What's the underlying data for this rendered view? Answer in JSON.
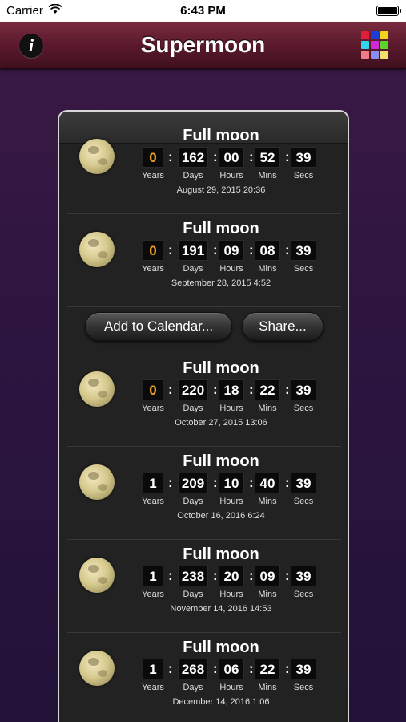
{
  "status_bar": {
    "carrier": "Carrier",
    "time": "6:43 PM"
  },
  "nav": {
    "title": "Supermoon",
    "info_label": "i"
  },
  "unit_labels": {
    "years": "Years",
    "days": "Days",
    "hours": "Hours",
    "mins": "Mins",
    "secs": "Secs"
  },
  "separator": ":",
  "actions": {
    "add_calendar": "Add to Calendar...",
    "share": "Share..."
  },
  "colors": {
    "accent_orange": "#f0a020",
    "nav_bar": "#5a1a2c",
    "panel": "#222222"
  },
  "events": [
    {
      "title": "Full moon",
      "years": "0",
      "days": "162",
      "hours": "00",
      "mins": "52",
      "secs": "39",
      "date": "August 29, 2015  20:36"
    },
    {
      "title": "Full moon",
      "years": "0",
      "days": "191",
      "hours": "09",
      "mins": "08",
      "secs": "39",
      "date": "September 28, 2015  4:52"
    },
    {
      "title": "Full moon",
      "years": "0",
      "days": "220",
      "hours": "18",
      "mins": "22",
      "secs": "39",
      "date": "October 27, 2015  13:06"
    },
    {
      "title": "Full moon",
      "years": "1",
      "days": "209",
      "hours": "10",
      "mins": "40",
      "secs": "39",
      "date": "October 16, 2016  6:24"
    },
    {
      "title": "Full moon",
      "years": "1",
      "days": "238",
      "hours": "20",
      "mins": "09",
      "secs": "39",
      "date": "November 14, 2016  14:53"
    },
    {
      "title": "Full moon",
      "years": "1",
      "days": "268",
      "hours": "06",
      "mins": "22",
      "secs": "39",
      "date": "December 14, 2016  1:06"
    }
  ]
}
